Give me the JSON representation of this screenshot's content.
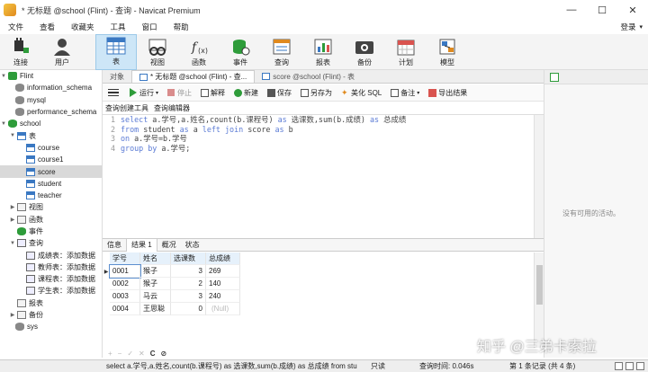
{
  "window": {
    "title": "* 无标题 @school (Flint) - 查询 - Navicat Premium",
    "controls": [
      "—",
      "☐",
      "✕"
    ]
  },
  "menu": {
    "items": [
      "文件",
      "查看",
      "收藏夹",
      "工具",
      "窗口",
      "帮助"
    ],
    "login": "登录"
  },
  "ribbon": {
    "buttons": [
      "连接",
      "用户",
      "表",
      "视图",
      "函数",
      "事件",
      "查询",
      "报表",
      "备份",
      "计划",
      "模型"
    ],
    "active": "表"
  },
  "sidebar": {
    "connection": "Flint",
    "databases": [
      "information_schema",
      "mysql",
      "performance_schema"
    ],
    "open_db": "school",
    "tables_label": "表",
    "tables": [
      "course",
      "course1",
      "score",
      "student",
      "teacher"
    ],
    "selected_table": "score",
    "views_label": "视图",
    "functions_label": "函数",
    "events_label": "事件",
    "queries_label": "查询",
    "queries": [
      "成绩表：添加数据",
      "教师表：添加数据",
      "课程表：添加数据",
      "学生表：添加数据"
    ],
    "reports_label": "报表",
    "backup_label": "备份",
    "sys": "sys"
  },
  "tabs": {
    "objects": "对象",
    "query_tab": "* 无标题 @school (Flint) - 查...",
    "table_tab": "score @school (Flint) - 表"
  },
  "query_toolbar": {
    "run": "运行",
    "stop": "停止",
    "explain": "解释",
    "new": "新建",
    "save": "保存",
    "save_as": "另存为",
    "beautify": "美化 SQL",
    "note": "备注",
    "export": "导出结果"
  },
  "subtabs": [
    "查询创建工具",
    "查询编辑器"
  ],
  "editor": {
    "lines": [
      {
        "no": "1",
        "parts": [
          [
            "kw",
            "select "
          ],
          [
            "c",
            "a.学号,a.姓名,count(b.课程号) "
          ],
          [
            "kw",
            "as "
          ],
          [
            "c",
            "选课数,sum(b.成绩) "
          ],
          [
            "kw",
            "as "
          ],
          [
            "c",
            "总成绩"
          ]
        ]
      },
      {
        "no": "2",
        "parts": [
          [
            "kw",
            "from "
          ],
          [
            "c",
            "student "
          ],
          [
            "kw",
            "as "
          ],
          [
            "c",
            "a "
          ],
          [
            "kw",
            "left join "
          ],
          [
            "c",
            "score "
          ],
          [
            "kw",
            "as "
          ],
          [
            "c",
            "b"
          ]
        ]
      },
      {
        "no": "3",
        "parts": [
          [
            "kw",
            "on "
          ],
          [
            "c",
            "a.学号=b.学号"
          ]
        ]
      },
      {
        "no": "4",
        "parts": [
          [
            "kw",
            "group by "
          ],
          [
            "c",
            "a.学号;"
          ]
        ]
      }
    ]
  },
  "results": {
    "tabs": [
      "信息",
      "结果 1",
      "概况",
      "状态"
    ],
    "active_tab": "结果 1",
    "columns": [
      "学号",
      "姓名",
      "选课数",
      "总成绩"
    ],
    "rows": [
      [
        "0001",
        "猴子",
        "3",
        "269"
      ],
      [
        "0002",
        "猴子",
        "2",
        "140"
      ],
      [
        "0003",
        "马云",
        "3",
        "240"
      ],
      [
        "0004",
        "王思聪",
        "0",
        "(Null)"
      ]
    ],
    "navbar": [
      "+",
      "−",
      "✓",
      "✕",
      "C",
      "⊘"
    ]
  },
  "right_pane": {
    "empty_text": "没有可用的活动。",
    "watermark": "知乎 @三弟卡索拉"
  },
  "status": {
    "sql": "select a.学号,a.姓名,count(b.课程号) as 选课数,sum(b.成绩) as 总成绩 from stu",
    "read_only": "只读",
    "query_time": "查询时间: 0.046s",
    "record": "第 1 条记录 (共 4 条)"
  },
  "colors": {
    "keyword": "#5b7bd5",
    "ribbon_active": "#cde6f7",
    "tree_selected": "#d9d9d9",
    "grid_header": "#e6f1fb"
  }
}
